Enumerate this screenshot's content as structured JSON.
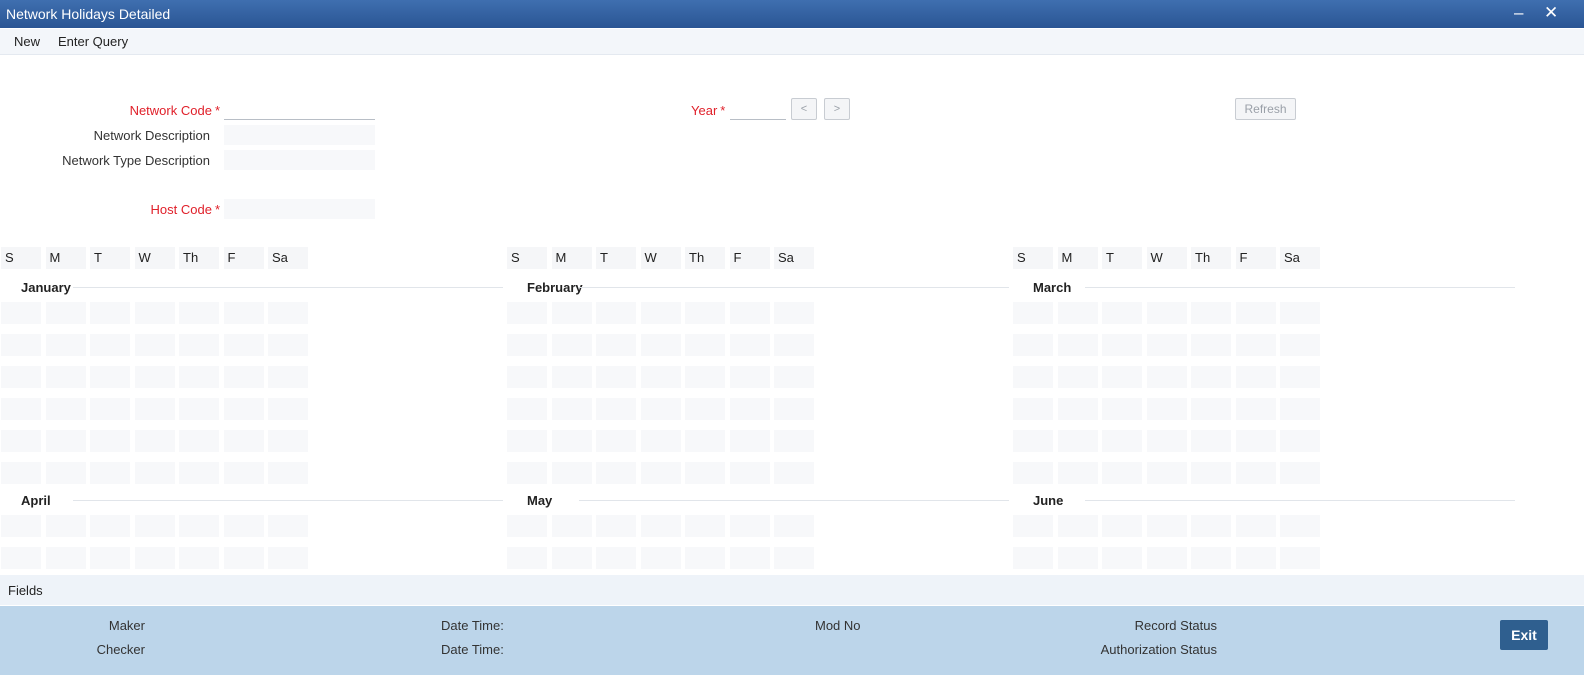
{
  "window": {
    "title": "Network Holidays Detailed",
    "minimize": "‒",
    "close": "✕"
  },
  "menu": {
    "new": "New",
    "enter_query": "Enter Query"
  },
  "form": {
    "network_code": {
      "label": "Network Code",
      "value": ""
    },
    "network_description": {
      "label": "Network Description",
      "value": ""
    },
    "network_type_description": {
      "label": "Network Type Description",
      "value": ""
    },
    "host_code": {
      "label": "Host Code",
      "value": ""
    },
    "year": {
      "label": "Year",
      "value": ""
    },
    "required_marker": "*",
    "prev_label": "<",
    "next_label": ">",
    "refresh_label": "Refresh"
  },
  "calendar": {
    "weekdays": [
      "S",
      "M",
      "T",
      "W",
      "Th",
      "F",
      "Sa"
    ],
    "months": [
      "January",
      "February",
      "March",
      "April",
      "May",
      "June"
    ]
  },
  "fields_label": "Fields",
  "footer": {
    "maker": "Maker",
    "checker": "Checker",
    "date_time_1": "Date Time:",
    "date_time_2": "Date Time:",
    "mod_no": "Mod No",
    "record_status": "Record Status",
    "authorization_status": "Authorization Status",
    "exit": "Exit"
  }
}
